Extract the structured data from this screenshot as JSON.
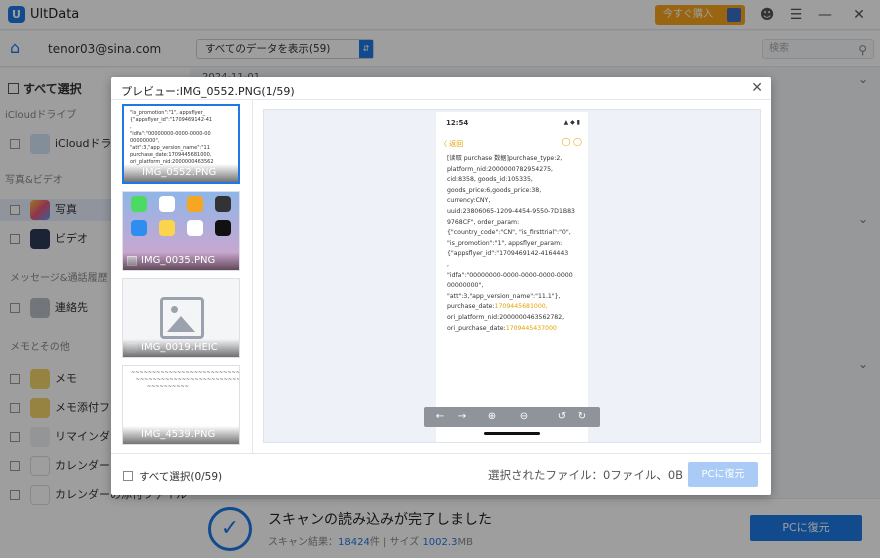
{
  "app": {
    "title": "UltData",
    "logo_letter": "U",
    "buy_label": "今すぐ購入"
  },
  "topbar": {
    "account": "tenor03@sina.com",
    "filter_value": "すべてのデータを表示(59)",
    "search_placeholder": "検索"
  },
  "sidebar": {
    "select_all": "すべて選択",
    "sections": {
      "icloud": "iCloudドライブ",
      "photo_video": "写真&ビデオ",
      "messages": "メッセージ&通話履歴",
      "memos": "メモとその他"
    },
    "items": {
      "icloud_drive": "iCloudドライ",
      "photos": "写真",
      "videos": "ビデオ",
      "contacts": "連絡先",
      "memo": "メモ",
      "memo_attach": "メモ添付ファ",
      "reminder": "リマインダー",
      "calendar": "カレンダー",
      "calendar_attach": "カレンダーの添付ファイル"
    }
  },
  "content": {
    "date_row": "2024-11-01"
  },
  "bottom": {
    "title": "スキャンの読み込みが完了しました",
    "result_label": "スキャン結果：",
    "result_count": "18424",
    "result_unit": "件",
    "size_label": "サイズ",
    "size_value": "1002.3",
    "size_unit": "MB",
    "restore_label": "PCに復元"
  },
  "modal": {
    "title": "プレビュー:IMG_0552.PNG(1/59)",
    "thumbs": [
      {
        "name": "IMG_0552.PNG"
      },
      {
        "name": "IMG_0035.PNG"
      },
      {
        "name": "IMG_0019.HEIC"
      },
      {
        "name": "IMG_4539.PNG"
      }
    ],
    "select_all": "すべて選択(0/59)",
    "selected_files": "選択されたファイル：0ファイル、0B",
    "restore_label": "PCに復元",
    "phone": {
      "time": "12:54",
      "status": "▲ ◆ ▮",
      "back_label": "〈 返回",
      "lines": [
        "[读取 purchase 数据]purchase_type:2,",
        "platform_nid:2000000782954275,",
        "cid:8358, goods_id:105335,",
        "goods_price:6,goods_price:38,",
        "currency:CNY,",
        "uuid:23806065-1209-4454-9550-7D1B83",
        "9768CF\", order_param:",
        "{\"country_code\":\"CN\", \"is_firsttrial\":\"0\",",
        "\"is_promotion\":\"1\", appsflyer_param:",
        "{\"appsflyer_id\":\"1709469142-4164443",
        ",",
        "\"idfa\":\"00000000-0000-0000-0000-0000",
        "00000000\",",
        "\"att\":3,\"app_version_name\":\"11.1\"},"
      ],
      "yellow_lines": [
        {
          "label": "purchase_date:",
          "value": "1709445681000,"
        },
        {
          "label": "ori_platform_nid:",
          "value": "2000000463562782,"
        },
        {
          "label": "ori_purchase_date:",
          "value": "1709445437000"
        }
      ]
    }
  }
}
